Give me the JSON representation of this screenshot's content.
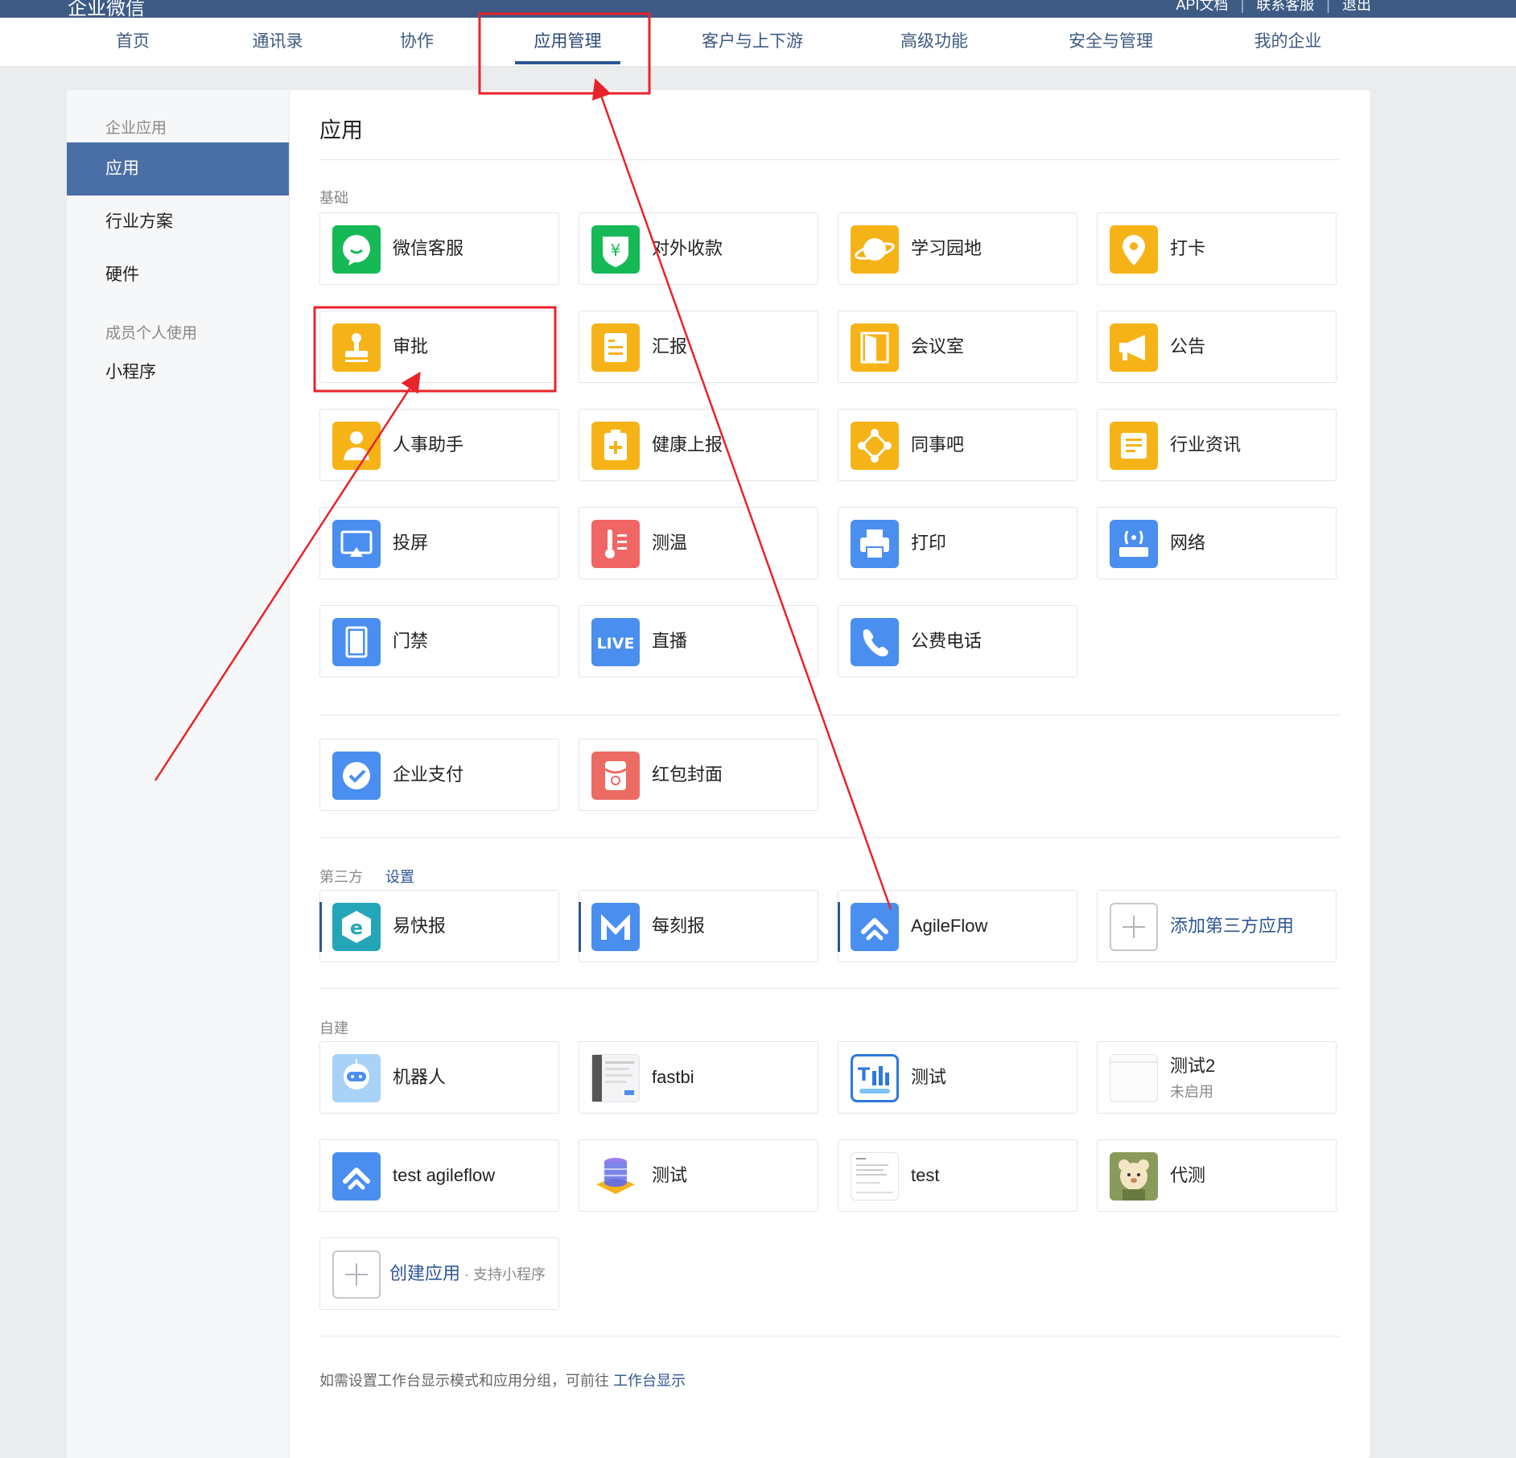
{
  "header": {
    "logo_text": "企业微信",
    "links": [
      "API文档",
      "联系客服",
      "退出"
    ]
  },
  "nav": {
    "items": [
      {
        "label": "首页"
      },
      {
        "label": "通讯录"
      },
      {
        "label": "协作"
      },
      {
        "label": "应用管理"
      },
      {
        "label": "客户与上下游"
      },
      {
        "label": "高级功能"
      },
      {
        "label": "安全与管理"
      },
      {
        "label": "我的企业"
      }
    ],
    "active": "应用管理"
  },
  "sidebar": {
    "group1": "企业应用",
    "items1": [
      "应用",
      "行业方案",
      "硬件"
    ],
    "group2": "成员个人使用",
    "items2": [
      "小程序"
    ],
    "active": "应用"
  },
  "main": {
    "title": "应用",
    "basic_label": "基础",
    "basic_apps": [
      {
        "name": "微信客服",
        "icon": "chat-bubble-icon"
      },
      {
        "name": "对外收款",
        "icon": "yuan-shield-icon"
      },
      {
        "name": "学习园地",
        "icon": "planet-icon"
      },
      {
        "name": "打卡",
        "icon": "location-pin-icon"
      },
      {
        "name": "审批",
        "icon": "stamp-icon"
      },
      {
        "name": "汇报",
        "icon": "report-doc-icon"
      },
      {
        "name": "会议室",
        "icon": "door-icon"
      },
      {
        "name": "公告",
        "icon": "megaphone-icon"
      },
      {
        "name": "人事助手",
        "icon": "hr-person-icon"
      },
      {
        "name": "健康上报",
        "icon": "health-clipboard-icon"
      },
      {
        "name": "同事吧",
        "icon": "network-nodes-icon"
      },
      {
        "name": "行业资讯",
        "icon": "news-icon"
      },
      {
        "name": "投屏",
        "icon": "screen-cast-icon"
      },
      {
        "name": "测温",
        "icon": "thermometer-icon"
      },
      {
        "name": "打印",
        "icon": "printer-icon"
      },
      {
        "name": "网络",
        "icon": "router-icon"
      },
      {
        "name": "门禁",
        "icon": "door-access-icon"
      },
      {
        "name": "直播",
        "icon": "live-icon"
      },
      {
        "name": "公费电话",
        "icon": "phone-icon"
      }
    ],
    "pay_apps": [
      {
        "name": "企业支付",
        "icon": "pay-icon"
      },
      {
        "name": "红包封面",
        "icon": "red-packet-icon"
      }
    ],
    "third_label": "第三方",
    "third_settings": "设置",
    "third_apps": [
      {
        "name": "易快报",
        "icon": "ekuaibao-icon"
      },
      {
        "name": "每刻报",
        "icon": "maycur-icon"
      },
      {
        "name": "AgileFlow",
        "icon": "agileflow-icon"
      }
    ],
    "add_third": "添加第三方应用",
    "custom_label": "自建",
    "custom_apps": [
      {
        "name": "机器人",
        "icon": "robot-icon"
      },
      {
        "name": "fastbi",
        "icon": "fastbi-icon"
      },
      {
        "name": "测试",
        "icon": "chart-icon"
      },
      {
        "name": "测试2",
        "sub": "未启用",
        "icon": "blank-app-icon"
      },
      {
        "name": "test agileflow",
        "icon": "agileflow-icon"
      },
      {
        "name": "测试",
        "icon": "database-icon"
      },
      {
        "name": "test",
        "icon": "doc-thumb-icon"
      },
      {
        "name": "代测",
        "icon": "bear-icon"
      }
    ],
    "create_app": "创建应用",
    "create_app_note": " · 支持小程序",
    "footer_text": "如需设置工作台显示模式和应用分组，可前往",
    "footer_link": "工作台显示"
  },
  "colors": {
    "topbar": "#3d5b84",
    "accent": "#2f5694",
    "sidebar_active": "#4a6fa7",
    "annotation": "#e8232a"
  }
}
